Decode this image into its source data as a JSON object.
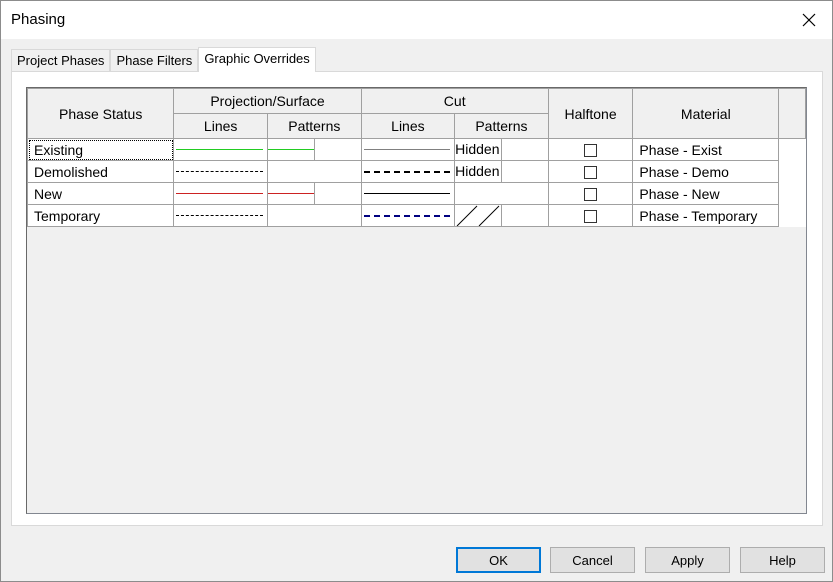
{
  "window": {
    "title": "Phasing"
  },
  "tabs": [
    {
      "label": "Project Phases"
    },
    {
      "label": "Phase Filters"
    },
    {
      "label": "Graphic Overrides"
    }
  ],
  "grid": {
    "headers": {
      "phase_status": "Phase Status",
      "projection_surface": "Projection/Surface",
      "cut": "Cut",
      "halftone": "Halftone",
      "material": "Material",
      "lines": "Lines",
      "patterns": "Patterns"
    },
    "rows": [
      {
        "status": "Existing",
        "proj_line_color": "#22cc22",
        "proj_line_style": "solid",
        "proj_pattern_color": "#22cc22",
        "cut_line_color": "#808080",
        "cut_line_style": "solid",
        "cut_pattern": "Hidden",
        "halftone": false,
        "material": "Phase - Exist"
      },
      {
        "status": "Demolished",
        "proj_line_color": "#000000",
        "proj_line_style": "dashed",
        "proj_pattern_color": "",
        "cut_line_color": "#000000",
        "cut_line_style": "dashed",
        "cut_pattern": "Hidden",
        "halftone": false,
        "material": "Phase - Demo"
      },
      {
        "status": "New",
        "proj_line_color": "#cc2222",
        "proj_line_style": "solid",
        "proj_pattern_color": "#cc2222",
        "cut_line_color": "#000000",
        "cut_line_style": "solid",
        "cut_pattern": "",
        "halftone": false,
        "material": "Phase - New"
      },
      {
        "status": "Temporary",
        "proj_line_color": "#000000",
        "proj_line_style": "dashed",
        "proj_pattern_color": "",
        "cut_line_color": "#000080",
        "cut_line_style": "dashed",
        "cut_pattern": "diagonal",
        "halftone": false,
        "material": "Phase - Temporary"
      }
    ]
  },
  "buttons": {
    "ok": "OK",
    "cancel": "Cancel",
    "apply": "Apply",
    "help": "Help"
  },
  "colors": {
    "accent": "#0078d7"
  }
}
